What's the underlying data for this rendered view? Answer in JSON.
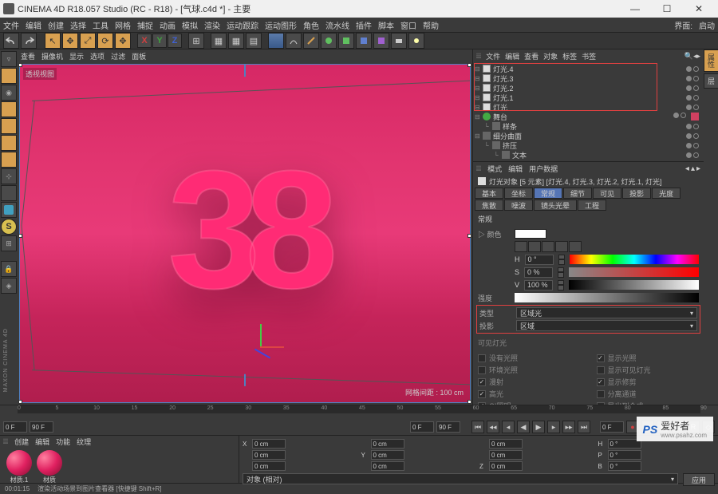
{
  "window": {
    "title": "CINEMA 4D R18.057 Studio (RC - R18) - [气球.c4d *] - 主要",
    "close": "✕",
    "max": "☐",
    "min": "—"
  },
  "menubar": [
    "文件",
    "编辑",
    "创建",
    "选择",
    "工具",
    "网格",
    "捕捉",
    "动画",
    "模拟",
    "渲染",
    "运动跟踪",
    "运动图形",
    "角色",
    "流水线",
    "插件",
    "脚本",
    "窗口",
    "帮助"
  ],
  "layout_buttons": {
    "a": "界面:",
    "b": "启动"
  },
  "viewport": {
    "menu": [
      "查看",
      "摄像机",
      "显示",
      "选项",
      "过滤",
      "面板"
    ],
    "label": "透视视图",
    "grid_label": "网格间距 : 100 cm",
    "number": "38"
  },
  "objmgr": {
    "menu": [
      "文件",
      "编辑",
      "查看",
      "对象",
      "标签",
      "书签"
    ],
    "items": [
      {
        "name": "灯光.4",
        "indent": 0,
        "icon": "light"
      },
      {
        "name": "灯光.3",
        "indent": 0,
        "icon": "light"
      },
      {
        "name": "灯光.2",
        "indent": 0,
        "icon": "light"
      },
      {
        "name": "灯光.1",
        "indent": 0,
        "icon": "light"
      },
      {
        "name": "灯光",
        "indent": 0,
        "icon": "light"
      },
      {
        "name": "舞台",
        "indent": 0,
        "icon": "green",
        "tag": true
      },
      {
        "name": "样条",
        "indent": 1,
        "icon": "null"
      },
      {
        "name": "细分曲面",
        "indent": 0,
        "icon": "null"
      },
      {
        "name": "挤压",
        "indent": 1,
        "icon": "null"
      },
      {
        "name": "文本",
        "indent": 2,
        "icon": "null"
      }
    ]
  },
  "attr": {
    "menu": [
      "模式",
      "编辑",
      "用户数据"
    ],
    "title_icon": "light",
    "title": "灯光对象 [5 元素] [灯光.4, 灯光.3, 灯光.2, 灯光.1, 灯光]",
    "tabs": [
      "基本",
      "坐标",
      "常规",
      "细节",
      "可见",
      "投影",
      "光度",
      "焦散",
      "噪波",
      "镜头光晕",
      "工程"
    ],
    "active_tab": 2,
    "section": "常规",
    "color_label": "▷ 颜色",
    "h_label": "H",
    "h_val": "0 °",
    "s_label": "S",
    "s_val": "0 %",
    "v_label": "V",
    "v_val": "100 %",
    "intensity_label": "强度",
    "type_label": "类型",
    "type_val": "区域光",
    "shadow_label": "投影",
    "shadow_val": "区域",
    "vis_section": "可见灯光",
    "checks": [
      [
        "没有光照",
        "显示光照"
      ],
      [
        "环境光照",
        "显示可见灯光"
      ],
      [
        "漫射",
        "显示修剪"
      ],
      [
        "高光",
        "分离通道"
      ],
      [
        "GI照明",
        "导出到合成"
      ]
    ],
    "checked": {
      "漫射": true,
      "高光": true,
      "GI照明": true,
      "显示光照": true,
      "显示修剪": true
    }
  },
  "timeline": {
    "ticks": [
      "0",
      "5",
      "10",
      "15",
      "20",
      "25",
      "30",
      "35",
      "40",
      "45",
      "50",
      "55",
      "60",
      "65",
      "70",
      "75",
      "80",
      "85",
      "90"
    ],
    "start1": "0 F",
    "end1": "90 F",
    "start2": "0 F",
    "end2": "90 F",
    "cur": "0 F"
  },
  "materials": {
    "tabs": [
      "创建",
      "编辑",
      "功能",
      "纹理"
    ],
    "items": [
      "材质.1",
      "材质"
    ]
  },
  "coords": {
    "rows": [
      {
        "X": "0 cm",
        "Y": "0 cm",
        "Z": "0 cm",
        "H": "0 °"
      },
      {
        "X": "0 cm",
        "Y": "0 cm",
        "Z": "0 cm",
        "P": "0 °"
      },
      {
        "X": "0 cm",
        "Y": "0 cm",
        "Z": "0 cm",
        "B": "0 °"
      }
    ],
    "sel": "对象 (相对)",
    "apply": "应用"
  },
  "status": {
    "time": "00:01:15",
    "msg": "渲染活动场景到图片查看器  [快捷键 Shift+R]"
  },
  "watermark": {
    "brand": "PS",
    "name": "爱好者",
    "url": "www.psahz.com"
  }
}
